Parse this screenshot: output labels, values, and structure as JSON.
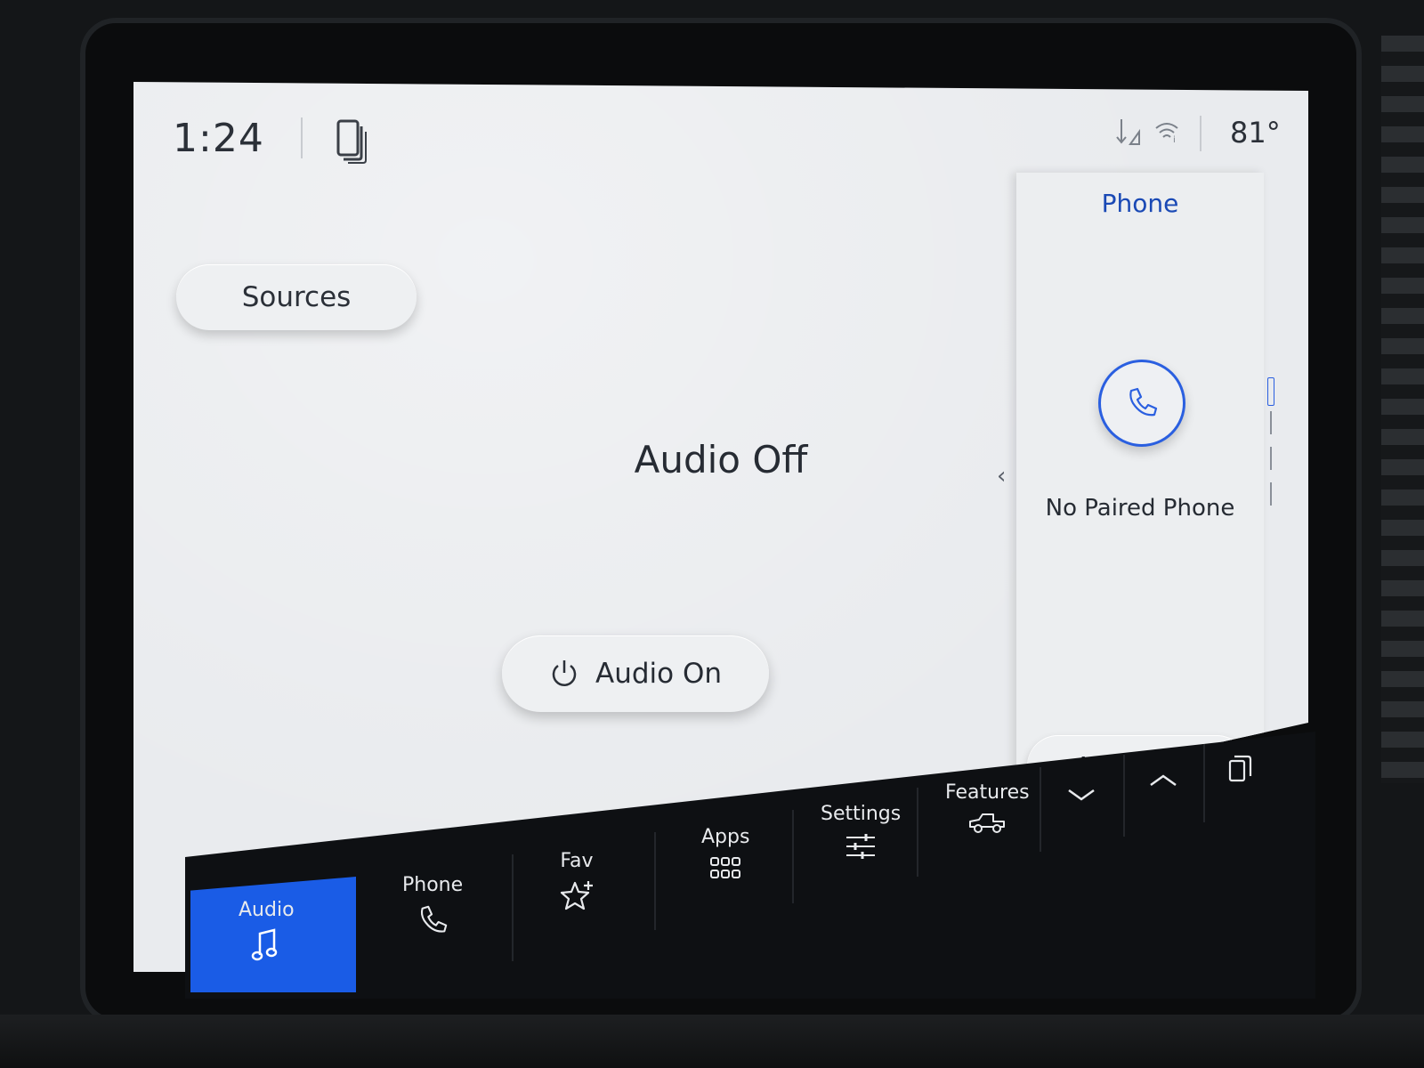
{
  "status_bar": {
    "time": "1:24",
    "temperature": "81°",
    "icons": [
      "phone-projection-icon",
      "signal-icon",
      "wifi-icon"
    ]
  },
  "main": {
    "sources_label": "Sources",
    "audio_status": "Audio Off",
    "audio_on_label": "Audio On"
  },
  "phone_panel": {
    "title": "Phone",
    "status": "No Paired Phone",
    "add_phone_label": "Add Phone"
  },
  "dock": {
    "items": [
      {
        "label": "Audio",
        "icon": "music-note-icon",
        "active": true
      },
      {
        "label": "Phone",
        "icon": "phone-icon",
        "active": false
      },
      {
        "label": "Fav",
        "icon": "star-plus-icon",
        "active": false
      },
      {
        "label": "Apps",
        "icon": "apps-grid-icon",
        "active": false
      },
      {
        "label": "Settings",
        "icon": "sliders-icon",
        "active": false
      },
      {
        "label": "Features",
        "icon": "truck-icon",
        "active": false
      }
    ],
    "controls": [
      "chevron-down-icon",
      "chevron-up-icon",
      "copy-screens-icon"
    ]
  },
  "colors": {
    "accent": "#1a5ce6",
    "phone_title": "#1a49b5",
    "screen_bg": "#e9ebee",
    "dock_bg": "#0e1013"
  }
}
